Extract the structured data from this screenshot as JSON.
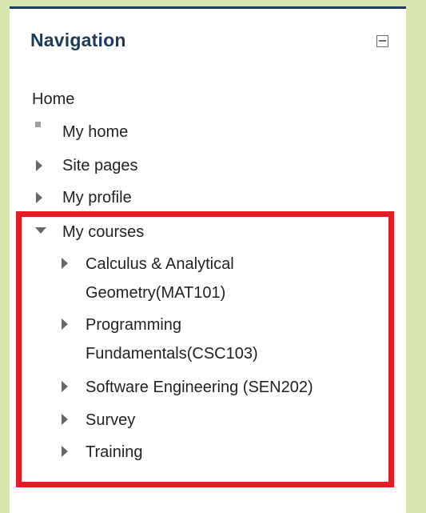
{
  "navigation": {
    "title": "Navigation",
    "home": "Home",
    "items": [
      {
        "label": "My home"
      },
      {
        "label": "Site pages"
      },
      {
        "label": "My profile"
      },
      {
        "label": "My courses"
      }
    ],
    "courses": [
      {
        "label": "Calculus & Analytical Geometry(MAT101)"
      },
      {
        "label": "Programming Fundamentals(CSC103)"
      },
      {
        "label": "Software Engineering (SEN202)"
      },
      {
        "label": "Survey"
      },
      {
        "label": "Training"
      }
    ]
  },
  "colors": {
    "background": "#d6e6ad",
    "title": "#1b3b5a",
    "highlight_border": "#e51c23"
  },
  "icons": {
    "collapse": "collapse-block-icon",
    "expand": "triangle-right-icon",
    "expanded": "triangle-down-icon",
    "leaf": "square-bullet-icon"
  }
}
